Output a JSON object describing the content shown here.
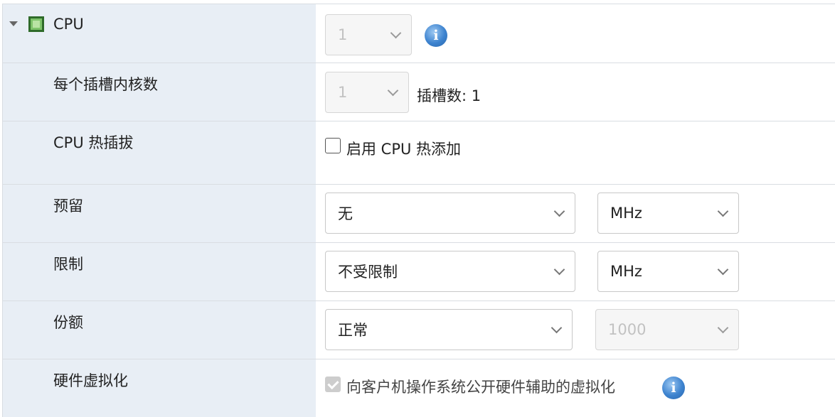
{
  "cpu": {
    "label": "CPU",
    "count_value": "1"
  },
  "cores_per_socket": {
    "label": "每个插槽内核数",
    "value": "1",
    "sockets_text": "插槽数: 1"
  },
  "hotplug": {
    "label": "CPU 热插拔",
    "checkbox_label": "启用 CPU 热添加",
    "checked": false
  },
  "reservation": {
    "label": "预留",
    "value": "无",
    "unit": "MHz"
  },
  "limit": {
    "label": "限制",
    "value": "不受限制",
    "unit": "MHz"
  },
  "shares": {
    "label": "份额",
    "value": "正常",
    "amount": "1000"
  },
  "hw_virtualization": {
    "label": "硬件虚拟化",
    "checkbox_label": "向客户机操作系统公开硬件辅助的虚拟化",
    "checked": true
  },
  "colors": {
    "label_column_bg": "#e8eef5",
    "border": "#d9dde2",
    "info_blue": "#3d83cf"
  },
  "icons": {
    "expand": "caret-down-icon",
    "cpu": "cpu-chip-icon",
    "info": "info-icon"
  }
}
